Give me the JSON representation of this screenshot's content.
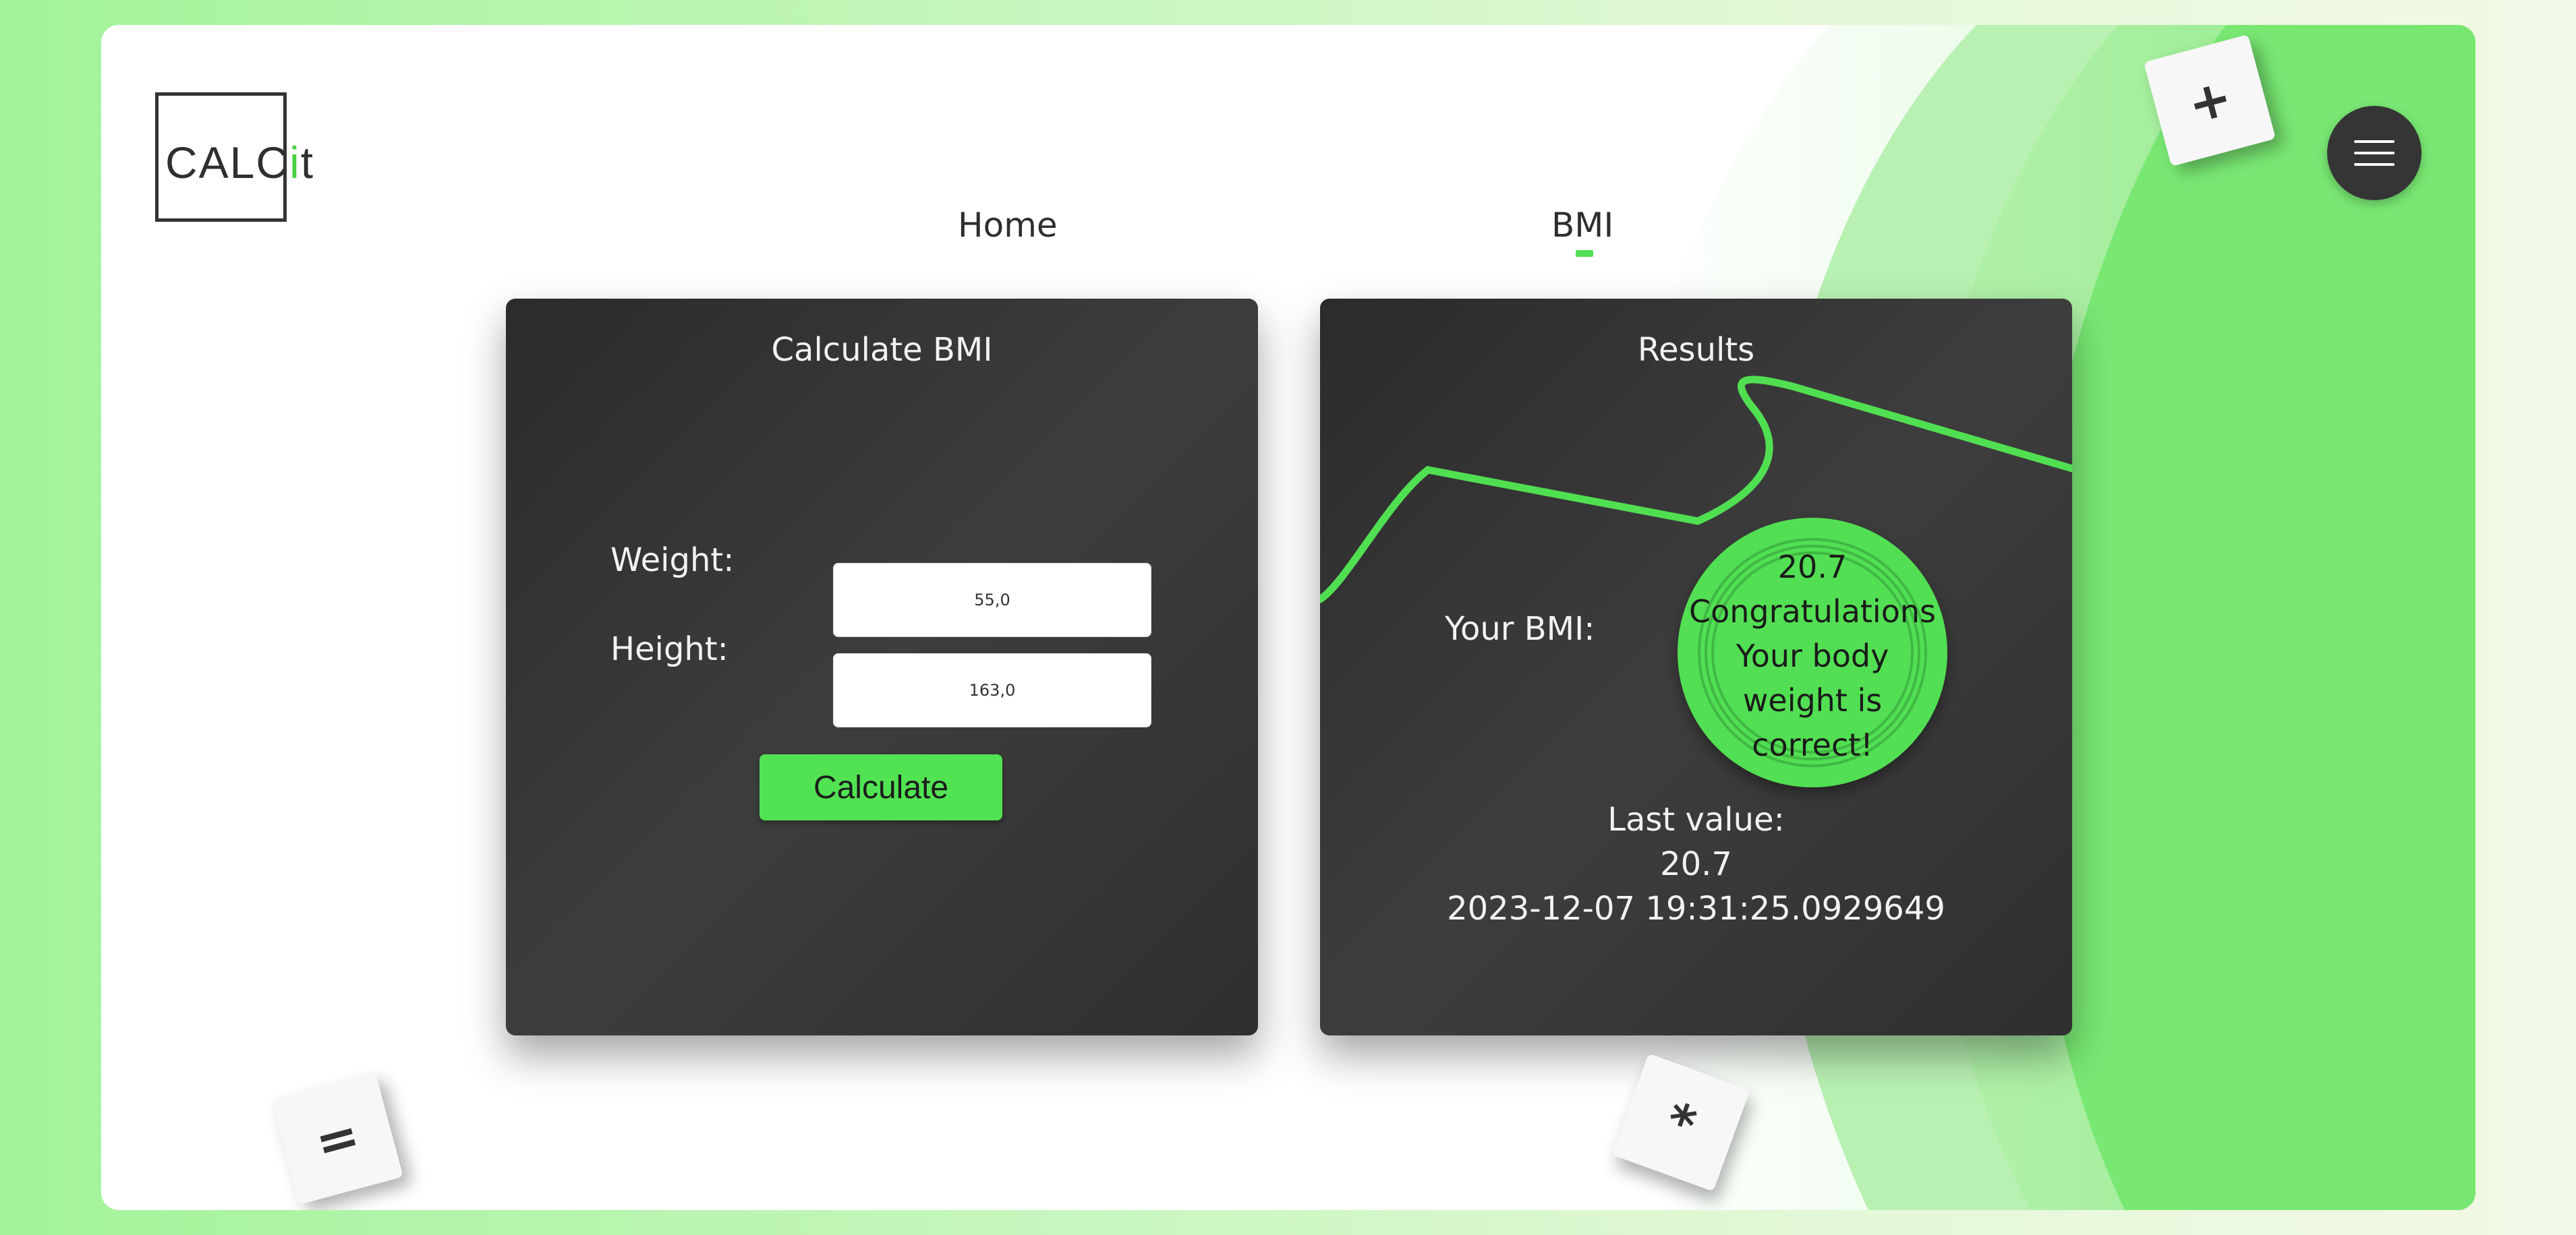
{
  "brand": {
    "logo_prefix": "CALC",
    "logo_highlight": "i",
    "logo_suffix": "t"
  },
  "nav": {
    "home": "Home",
    "bmi": "BMI",
    "active": "BMI"
  },
  "calculator": {
    "title": "Calculate BMI",
    "weight_label": "Weight:",
    "height_label": "Height:",
    "weight_value": "55,0",
    "height_value": "163,0",
    "calculate_label": "Calculate"
  },
  "results": {
    "title": "Results",
    "bmi_label": "Your BMI:",
    "bmi_value": "20.7",
    "message_line1": "Congratulations",
    "message_line2": "Your body",
    "message_line3": "weight is",
    "message_line4": "correct!",
    "last_value_label": "Last value:",
    "last_value": "20.7",
    "last_value_timestamp": "2023-12-07 19:31:25.0929649"
  },
  "decorations": {
    "tile_plus": "+",
    "tile_equals": "=",
    "tile_star": "*"
  },
  "colors": {
    "accent": "#53e054",
    "card_bg": "#353535",
    "text_light": "#f2f2f2"
  },
  "icons": {
    "menu": "hamburger-menu-icon"
  }
}
